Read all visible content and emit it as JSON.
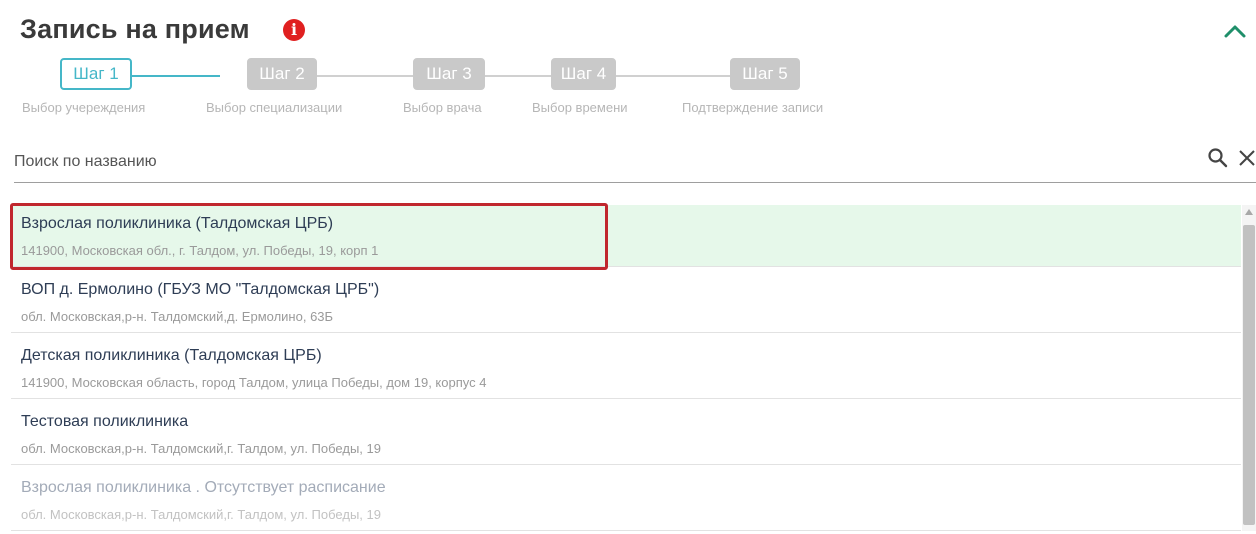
{
  "header": {
    "title": "Запись на прием",
    "info_icon": "i"
  },
  "stepper": {
    "steps": [
      {
        "label": "Шаг 1",
        "caption": "Выбор учереждения",
        "active": true
      },
      {
        "label": "Шаг 2",
        "caption": "Выбор специализации",
        "active": false
      },
      {
        "label": "Шаг 3",
        "caption": "Выбор врача",
        "active": false
      },
      {
        "label": "Шаг 4",
        "caption": "Выбор времени",
        "active": false
      },
      {
        "label": "Шаг 5",
        "caption": "Подтверждение записи",
        "active": false
      }
    ]
  },
  "search": {
    "placeholder": "Поиск по названию",
    "value": ""
  },
  "facilities": [
    {
      "name": "Взрослая поликлиника (Талдомская ЦРБ)",
      "address": "141900, Московская обл., г. Талдом, ул. Победы, 19, корп 1",
      "selected": true
    },
    {
      "name": "ВОП д. Ермолино (ГБУЗ МО \"Талдомская ЦРБ\")",
      "address": "обл. Московская,р-н. Талдомский,д. Ермолино, 63Б"
    },
    {
      "name": "Детская поликлиника (Талдомская ЦРБ)",
      "address": "141900, Московская область, город Талдом, улица Победы, дом 19, корпус 4"
    },
    {
      "name": "Тестовая поликлиника",
      "address": "обл. Московская,р-н. Талдомский,г. Талдом, ул. Победы, 19"
    },
    {
      "name": "Взрослая поликлиника . Отсутствует расписание",
      "address": "обл. Московская,р-н. Талдомский,г. Талдом, ул. Победы, 19",
      "disabled": true
    }
  ],
  "colors": {
    "accent": "#45b7c8",
    "selected_bg": "#e6f8ea",
    "highlight_border": "#c0272d",
    "info": "#e02020",
    "collapse": "#1f8f6a"
  }
}
